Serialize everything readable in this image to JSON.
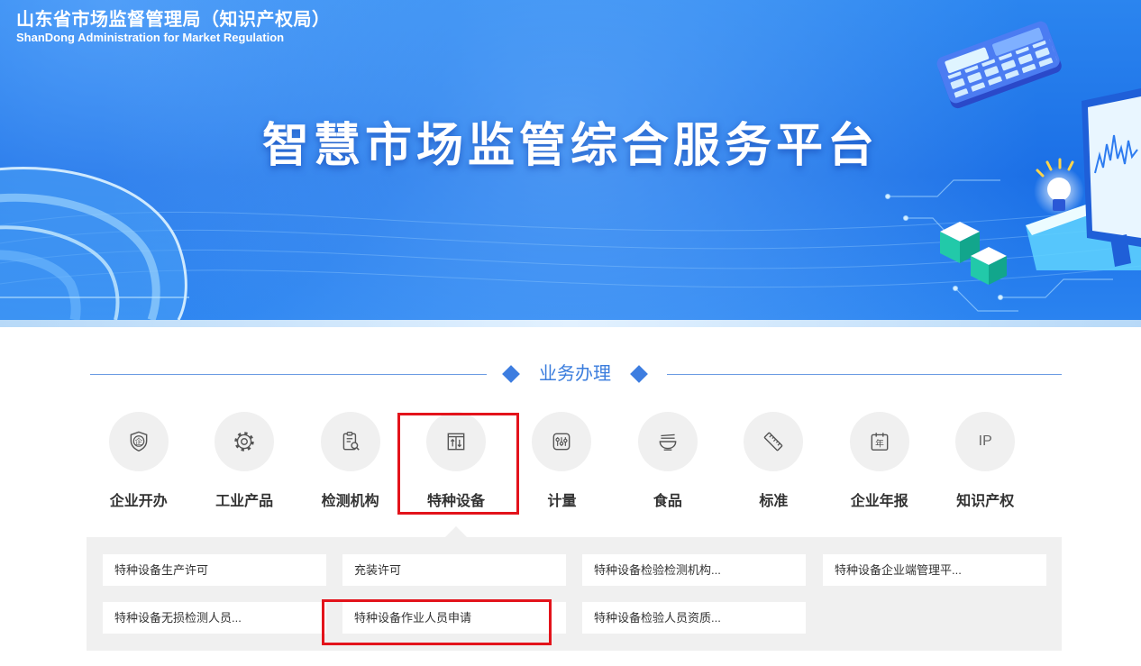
{
  "header": {
    "org_name_cn": "山东省市场监督管理局（知识产权局）",
    "org_name_en": "ShanDong Administration for Market Regulation",
    "platform_title": "智慧市场监管综合服务平台"
  },
  "section": {
    "title": "业务办理"
  },
  "categories": [
    {
      "label": "企业开办",
      "icon": "enterprise-shield-icon",
      "icon_text": "企"
    },
    {
      "label": "工业产品",
      "icon": "gear-icon"
    },
    {
      "label": "检测机构",
      "icon": "inspection-clipboard-icon"
    },
    {
      "label": "特种设备",
      "icon": "elevator-icon",
      "selected": true
    },
    {
      "label": "计量",
      "icon": "meter-icon"
    },
    {
      "label": "食品",
      "icon": "bowl-icon"
    },
    {
      "label": "标准",
      "icon": "ruler-icon"
    },
    {
      "label": "企业年报",
      "icon": "calendar-icon",
      "icon_text": "年"
    },
    {
      "label": "知识产权",
      "icon": "ip-icon",
      "icon_text": "IP"
    }
  ],
  "sub_items": [
    [
      "特种设备生产许可",
      "充装许可",
      "特种设备检验检测机构...",
      "特种设备企业端管理平..."
    ],
    [
      "特种设备无损检测人员...",
      "特种设备作业人员申请",
      "特种设备检验人员资质..."
    ]
  ],
  "colors": {
    "banner_blue": "#1b6fe6",
    "accent": "#3b7ddd",
    "highlight_red": "#e3131b",
    "panel_gray": "#f0f0f0",
    "label_text": "#333333"
  }
}
